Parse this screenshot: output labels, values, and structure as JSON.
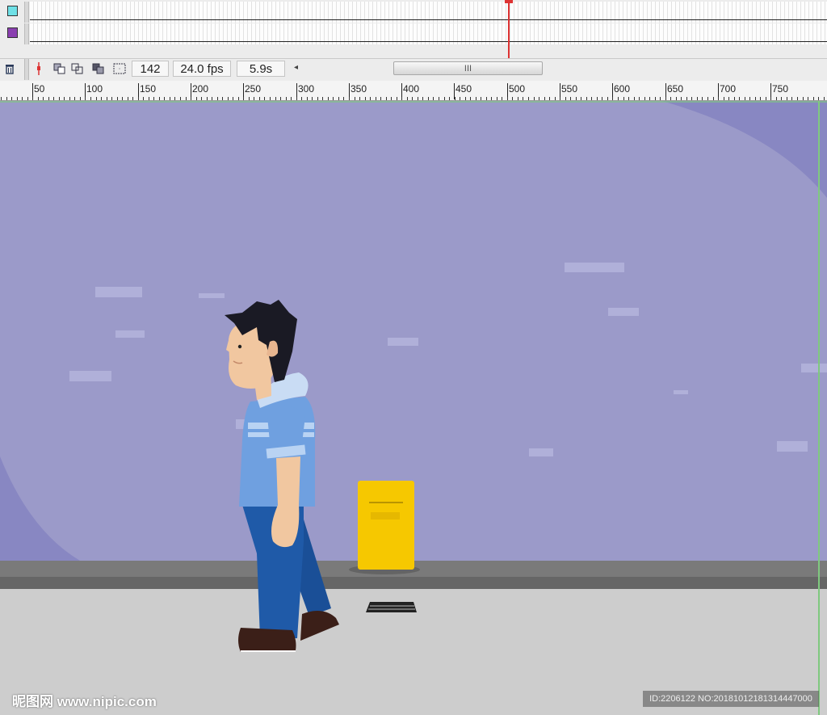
{
  "timeline": {
    "layers": [
      {
        "color": "#6fe0e6",
        "icon": "layer-color-swatch"
      },
      {
        "color": "#8a3fb0",
        "icon": "layer-color-swatch"
      }
    ],
    "frame_field": "142",
    "fps_field": "24.0 fps",
    "time_field": "5.9s",
    "scroll_arrow": "◂",
    "scroll_grip": "III"
  },
  "ruler": {
    "labels": [
      "50",
      "100",
      "150",
      "200",
      "250",
      "300",
      "350",
      "400",
      "450",
      "500",
      "550",
      "600",
      "650",
      "700",
      "750"
    ]
  },
  "watermarks": {
    "left": "昵图网 www.nipic.com",
    "right": "ID:2206122 NO:20181012181314447000"
  },
  "colors": {
    "sky": "#9b9ac9",
    "accent_playhead": "#dd3333",
    "shirt": "#6fa0e0",
    "jeans": "#1f5aa8",
    "mailbox": "#f6c800"
  }
}
